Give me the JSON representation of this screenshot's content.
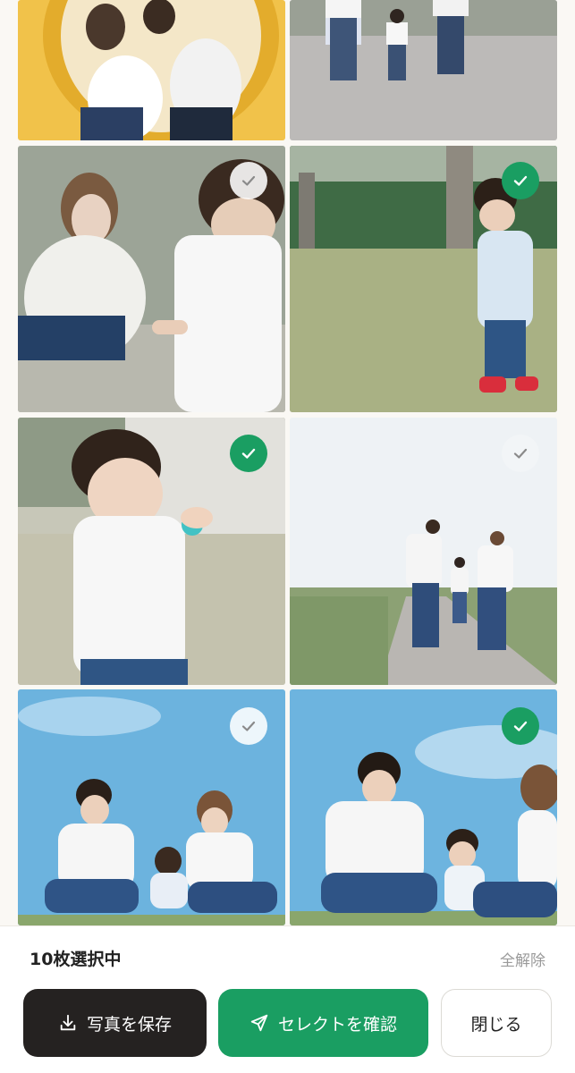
{
  "photos": [
    {
      "label": "photo-1",
      "selected": null
    },
    {
      "label": "photo-2",
      "selected": null
    },
    {
      "label": "photo-3",
      "selected": false
    },
    {
      "label": "photo-4",
      "selected": true
    },
    {
      "label": "photo-5",
      "selected": true
    },
    {
      "label": "photo-6",
      "selected": false
    },
    {
      "label": "photo-7",
      "selected": false
    },
    {
      "label": "photo-8",
      "selected": true
    }
  ],
  "footer": {
    "selected_count": "10枚選択中",
    "clear_all": "全解除",
    "save_label": "写真を保存",
    "confirm_label": "セレクトを確認",
    "close_label": "閉じる"
  },
  "colors": {
    "accent_green": "#1a9e62",
    "dark_button": "#252221",
    "background": "#faf8f4"
  },
  "icons": {
    "save": "download-icon",
    "confirm": "send-icon",
    "check": "checkmark-icon"
  }
}
